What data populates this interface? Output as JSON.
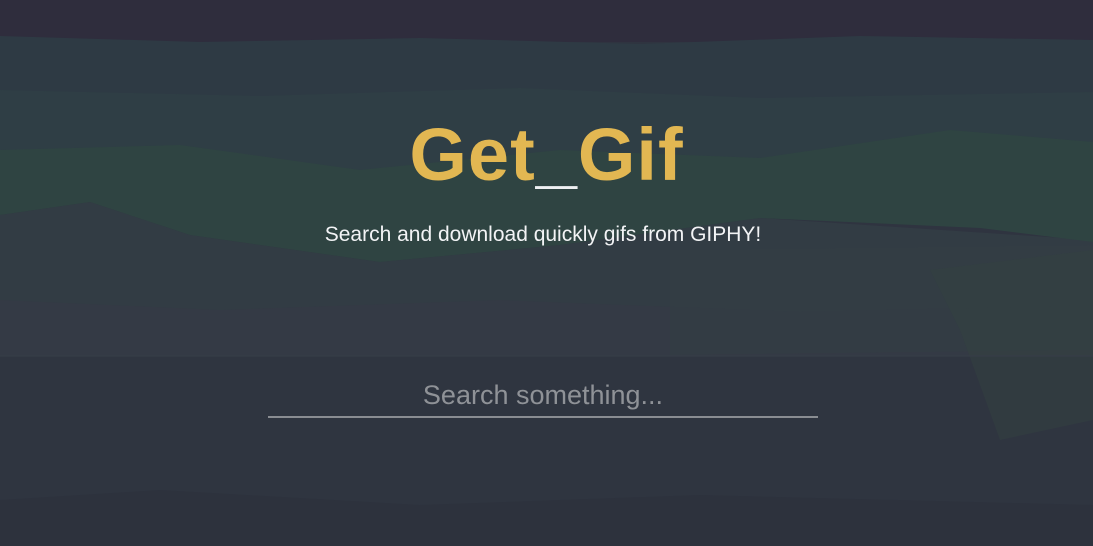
{
  "header": {
    "title_part1": "Get",
    "title_underscore": "_",
    "title_part2": "Gif",
    "subtitle": "Search and download quickly gifs from GIPHY!"
  },
  "search": {
    "placeholder": "Search something...",
    "value": ""
  },
  "colors": {
    "accent": "#e2b752",
    "background": "#2f3440",
    "text": "#f2f3f5"
  }
}
